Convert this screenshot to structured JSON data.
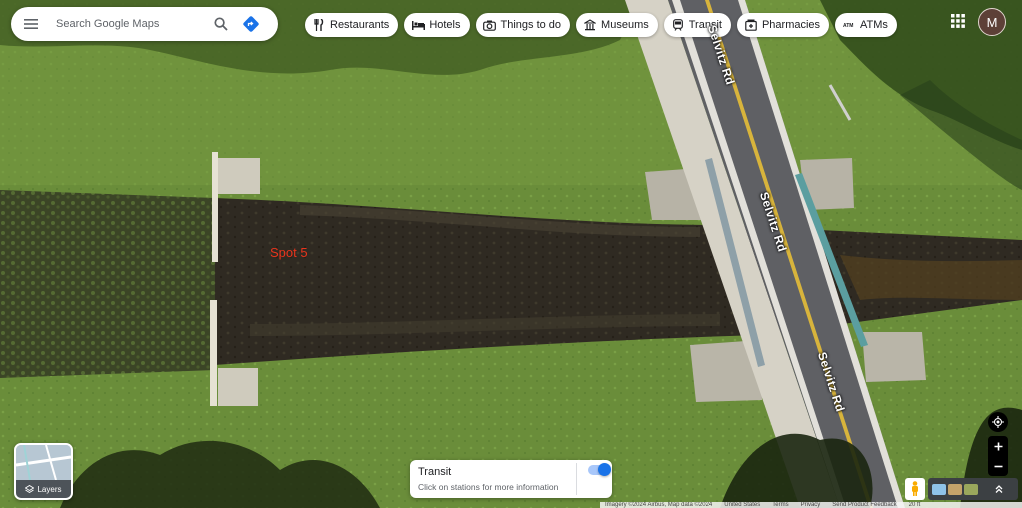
{
  "search": {
    "placeholder": "Search Google Maps"
  },
  "chips": [
    {
      "label": "Restaurants",
      "icon": "fork-knife-icon"
    },
    {
      "label": "Hotels",
      "icon": "bed-icon"
    },
    {
      "label": "Things to do",
      "icon": "camera-icon"
    },
    {
      "label": "Museums",
      "icon": "museum-icon"
    },
    {
      "label": "Transit",
      "icon": "train-icon"
    },
    {
      "label": "Pharmacies",
      "icon": "pharmacy-icon"
    },
    {
      "label": "ATMs",
      "icon": "atm-icon"
    }
  ],
  "account": {
    "initial": "M"
  },
  "map": {
    "marker_label": "Spot 5",
    "road_name": "Selvitz Rd"
  },
  "layers": {
    "label": "Layers"
  },
  "transit_panel": {
    "title": "Transit",
    "subtitle": "Click on stations for more information",
    "enabled": true
  },
  "footer": {
    "imagery": "Imagery ©2024 Airbus, Map data ©2024",
    "country": "United States",
    "terms": "Terms",
    "privacy": "Privacy",
    "feedback": "Send Product Feedback",
    "scale": "20 ft"
  },
  "colors": {
    "accent": "#1a73e8",
    "marker_text": "#e8341c"
  }
}
